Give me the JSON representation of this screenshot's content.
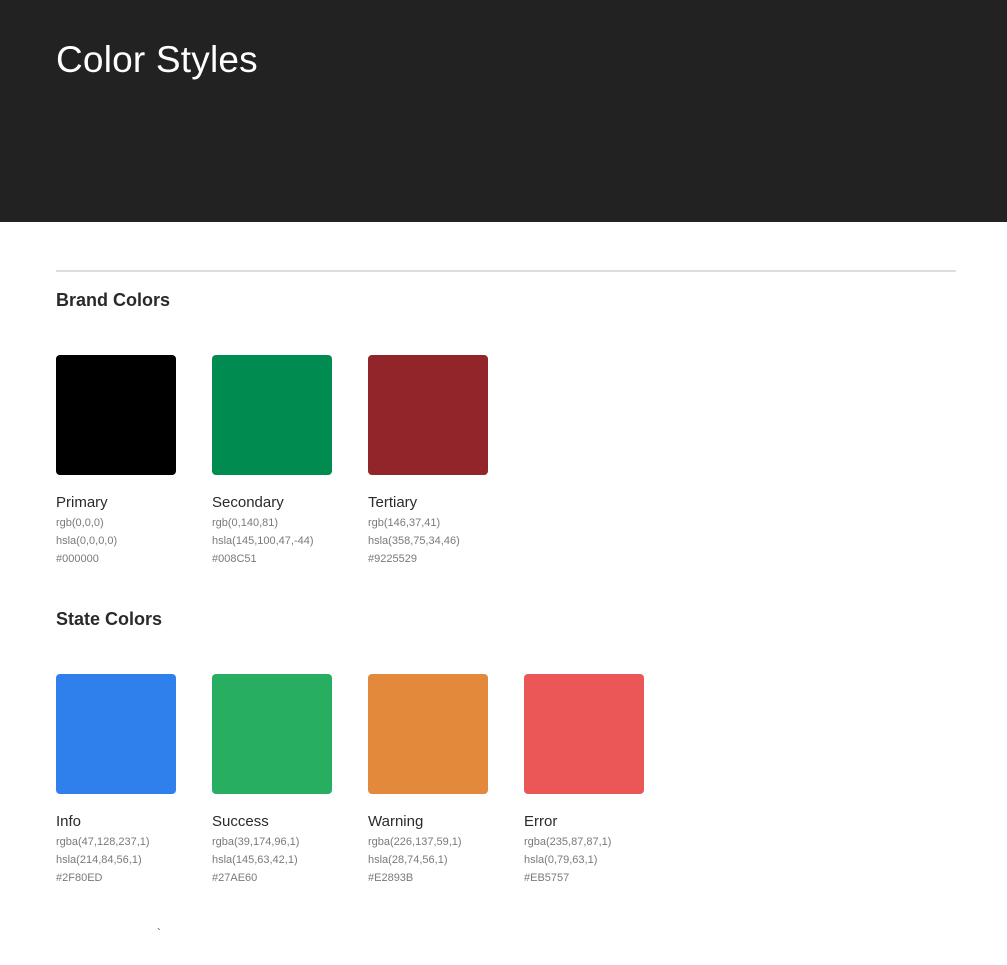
{
  "header": {
    "title": "Color Styles"
  },
  "brand": {
    "title": "Brand Colors",
    "colors": [
      {
        "name": "Primary",
        "rgb": "rgb(0,0,0)",
        "hsla": "hsla(0,0,0,0)",
        "hex": "#000000",
        "swatch": "#000000"
      },
      {
        "name": "Secondary",
        "rgb": "rgb(0,140,81)",
        "hsla": "hsla(145,100,47,-44)",
        "hex": "#008C51",
        "swatch": "#008C51"
      },
      {
        "name": "Tertiary",
        "rgb": "rgb(146,37,41)",
        "hsla": "hsla(358,75,34,46)",
        "hex": "#9225529",
        "swatch": "#922529"
      }
    ]
  },
  "state": {
    "title": "State Colors",
    "colors": [
      {
        "name": "Info",
        "rgb": "rgba(47,128,237,1)",
        "hsla": "hsla(214,84,56,1)",
        "hex": "#2F80ED",
        "swatch": "#2F80ED"
      },
      {
        "name": "Success",
        "rgb": "rgba(39,174,96,1)",
        "hsla": "hsla(145,63,42,1)",
        "hex": "#27AE60",
        "swatch": "#27AE60"
      },
      {
        "name": "Warning",
        "rgb": "rgba(226,137,59,1)",
        "hsla": "hsla(28,74,56,1)",
        "hex": "#E2893B",
        "swatch": "#E2893B"
      },
      {
        "name": "Error",
        "rgb": "rgba(235,87,87,1)",
        "hsla": "hsla(0,79,63,1)",
        "hex": "#EB5757",
        "swatch": "#EB5757"
      }
    ]
  },
  "footer": {
    "tick": "`"
  }
}
